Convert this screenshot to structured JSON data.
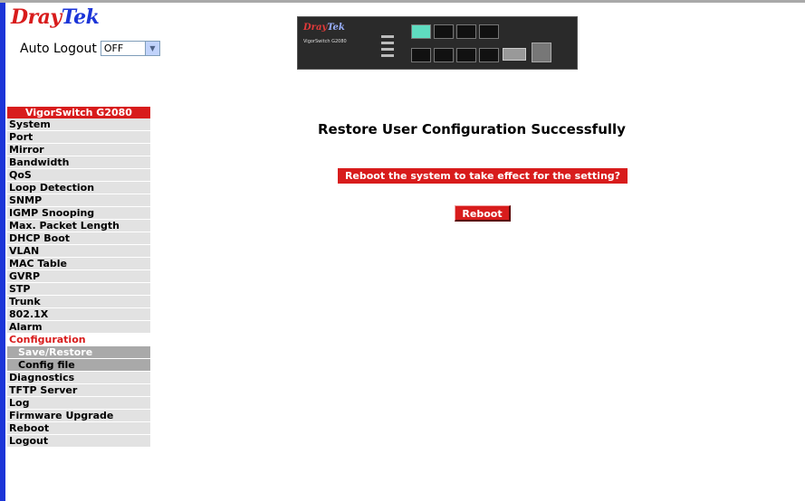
{
  "brand": {
    "part1": "Dray",
    "part2": "Tek"
  },
  "autologout": {
    "label": "Auto Logout",
    "value": "OFF"
  },
  "device": {
    "brand1": "Dray",
    "brand2": "Tek",
    "model": "VigorSwitch G2080"
  },
  "menu": {
    "title": "VigorSwitch G2080",
    "items": [
      "System",
      "Port",
      "Mirror",
      "Bandwidth",
      "QoS",
      "Loop Detection",
      "SNMP",
      "IGMP Snooping",
      "Max. Packet Length",
      "DHCP Boot",
      "VLAN",
      "MAC Table",
      "GVRP",
      "STP",
      "Trunk",
      "802.1X",
      "Alarm"
    ],
    "active": "Configuration",
    "sub_items": [
      "Save/Restore",
      "Config file"
    ],
    "items_after": [
      "Diagnostics",
      "TFTP Server",
      "Log",
      "Firmware Upgrade",
      "Reboot",
      "Logout"
    ]
  },
  "main": {
    "heading": "Restore User Configuration Successfully",
    "prompt": "Reboot the system to take effect for the setting?",
    "reboot_label": "Reboot"
  }
}
